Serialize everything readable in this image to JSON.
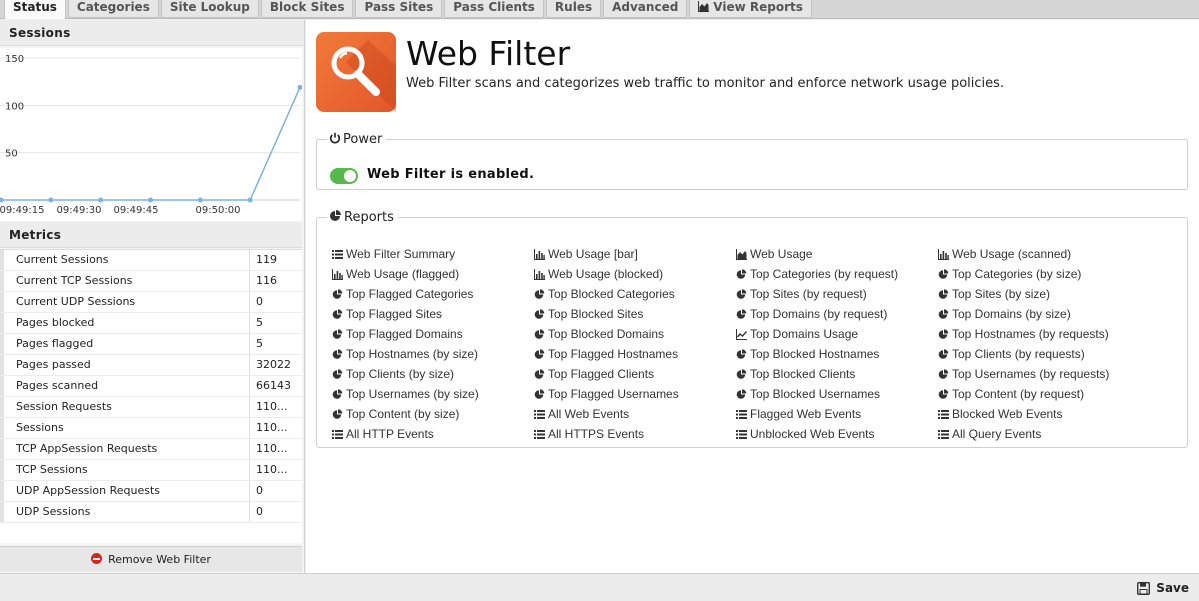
{
  "tabs": [
    {
      "label": "Status",
      "active": true
    },
    {
      "label": "Categories"
    },
    {
      "label": "Site Lookup"
    },
    {
      "label": "Block Sites"
    },
    {
      "label": "Pass Sites"
    },
    {
      "label": "Pass Clients"
    },
    {
      "label": "Rules"
    },
    {
      "label": "Advanced"
    },
    {
      "label": "View Reports",
      "icon": "area-chart-icon"
    }
  ],
  "sessions": {
    "title": "Sessions",
    "chart_data": {
      "type": "line",
      "x": [
        "09:49:15",
        "09:49:30",
        "09:49:45",
        "09:50:00"
      ],
      "x_labels": [
        "09:49:15",
        "09:49:30",
        "09:49:45",
        "09:50:00"
      ],
      "yticks": [
        "150",
        "100",
        "50"
      ],
      "ylim": [
        0,
        150
      ],
      "series": [
        {
          "values": [
            0,
            0,
            0,
            0,
            0,
            0,
            119
          ],
          "color": "#7fb0e0"
        }
      ]
    }
  },
  "metrics": {
    "title": "Metrics",
    "rows": [
      {
        "k": "Current Sessions",
        "v": "119"
      },
      {
        "k": "Current TCP Sessions",
        "v": "116"
      },
      {
        "k": "Current UDP Sessions",
        "v": "0"
      },
      {
        "k": "Pages blocked",
        "v": "5"
      },
      {
        "k": "Pages flagged",
        "v": "5"
      },
      {
        "k": "Pages passed",
        "v": "32022"
      },
      {
        "k": "Pages scanned",
        "v": "66143"
      },
      {
        "k": "Session Requests",
        "v": "110..."
      },
      {
        "k": "Sessions",
        "v": "110..."
      },
      {
        "k": "TCP AppSession Requests",
        "v": "110..."
      },
      {
        "k": "TCP Sessions",
        "v": "110..."
      },
      {
        "k": "UDP AppSession Requests",
        "v": "0"
      },
      {
        "k": "UDP Sessions",
        "v": "0"
      }
    ],
    "remove_label": "Remove Web Filter"
  },
  "app": {
    "title": "Web Filter",
    "description": "Web Filter scans and categorizes web traffic to monitor and enforce network usage policies.",
    "icon_color": "#ee6a30"
  },
  "power": {
    "legend": "Power",
    "status": "Web Filter is enabled.",
    "toggle_color": "#56b94a"
  },
  "reports": {
    "legend": "Reports",
    "items": [
      {
        "label": "Web Filter Summary",
        "icon": "list-icon"
      },
      {
        "label": "Web Usage [bar]",
        "icon": "bar-chart-icon"
      },
      {
        "label": "Web Usage",
        "icon": "area-chart-icon"
      },
      {
        "label": "Web Usage (scanned)",
        "icon": "bar-chart-icon"
      },
      {
        "label": "Web Usage (flagged)",
        "icon": "bar-chart-icon"
      },
      {
        "label": "Web Usage (blocked)",
        "icon": "bar-chart-icon"
      },
      {
        "label": "Top Categories (by request)",
        "icon": "pie-chart-icon"
      },
      {
        "label": "Top Categories (by size)",
        "icon": "pie-chart-icon"
      },
      {
        "label": "Top Flagged Categories",
        "icon": "pie-chart-icon"
      },
      {
        "label": "Top Blocked Categories",
        "icon": "pie-chart-icon"
      },
      {
        "label": "Top Sites (by request)",
        "icon": "pie-chart-icon"
      },
      {
        "label": "Top Sites (by size)",
        "icon": "pie-chart-icon"
      },
      {
        "label": "Top Flagged Sites",
        "icon": "pie-chart-icon"
      },
      {
        "label": "Top Blocked Sites",
        "icon": "pie-chart-icon"
      },
      {
        "label": "Top Domains (by request)",
        "icon": "pie-chart-icon"
      },
      {
        "label": "Top Domains (by size)",
        "icon": "pie-chart-icon"
      },
      {
        "label": "Top Flagged Domains",
        "icon": "pie-chart-icon"
      },
      {
        "label": "Top Blocked Domains",
        "icon": "pie-chart-icon"
      },
      {
        "label": "Top Domains Usage",
        "icon": "line-chart-icon"
      },
      {
        "label": "Top Hostnames (by requests)",
        "icon": "pie-chart-icon"
      },
      {
        "label": "Top Hostnames (by size)",
        "icon": "pie-chart-icon"
      },
      {
        "label": "Top Flagged Hostnames",
        "icon": "pie-chart-icon"
      },
      {
        "label": "Top Blocked Hostnames",
        "icon": "pie-chart-icon"
      },
      {
        "label": "Top Clients (by requests)",
        "icon": "pie-chart-icon"
      },
      {
        "label": "Top Clients (by size)",
        "icon": "pie-chart-icon"
      },
      {
        "label": "Top Flagged Clients",
        "icon": "pie-chart-icon"
      },
      {
        "label": "Top Blocked Clients",
        "icon": "pie-chart-icon"
      },
      {
        "label": "Top Usernames (by requests)",
        "icon": "pie-chart-icon"
      },
      {
        "label": "Top Usernames (by size)",
        "icon": "pie-chart-icon"
      },
      {
        "label": "Top Flagged Usernames",
        "icon": "pie-chart-icon"
      },
      {
        "label": "Top Blocked Usernames",
        "icon": "pie-chart-icon"
      },
      {
        "label": "Top Content (by request)",
        "icon": "pie-chart-icon"
      },
      {
        "label": "Top Content (by size)",
        "icon": "pie-chart-icon"
      },
      {
        "label": "All Web Events",
        "icon": "list-icon"
      },
      {
        "label": "Flagged Web Events",
        "icon": "list-icon"
      },
      {
        "label": "Blocked Web Events",
        "icon": "list-icon"
      },
      {
        "label": "All HTTP Events",
        "icon": "list-icon"
      },
      {
        "label": "All HTTPS Events",
        "icon": "list-icon"
      },
      {
        "label": "Unblocked Web Events",
        "icon": "list-icon"
      },
      {
        "label": "All Query Events",
        "icon": "list-icon"
      }
    ]
  },
  "footer": {
    "save_label": "Save"
  }
}
